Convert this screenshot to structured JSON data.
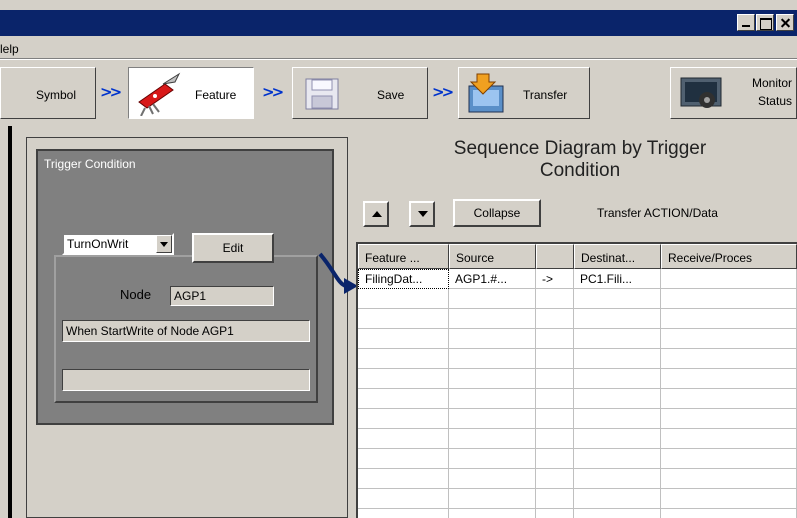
{
  "menu": {
    "help_label": "lelp"
  },
  "steps": {
    "symbol_label": "Symbol",
    "feature_label": "Feature",
    "save_label": "Save",
    "transfer_label": "Transfer",
    "monitor_label_1": "Monitor",
    "monitor_label_2": "Status"
  },
  "trigger": {
    "title": "Trigger Condition",
    "combo_value": "TurnOnWrit",
    "edit_label": "Edit",
    "node_label": "Node",
    "node_value": "AGP1",
    "description": "When StartWrite of Node AGP1",
    "extra_field": ""
  },
  "sequence": {
    "title_line1": "Sequence Diagram by Trigger",
    "title_line2": "Condition",
    "collapse_label": "Collapse",
    "transfer_action_label": "Transfer ACTION/Data"
  },
  "table": {
    "headers": [
      "Feature ...",
      "Source",
      "",
      "Destinat...",
      "Receive/Proces"
    ],
    "rows": [
      [
        "FilingDat...",
        "AGP1.#...",
        "->",
        "PC1.Fili...",
        ""
      ]
    ]
  },
  "colors": {
    "titlebar": "#0a246a",
    "arrow_accent": "#0033cc",
    "trigger_box": "#808080"
  }
}
